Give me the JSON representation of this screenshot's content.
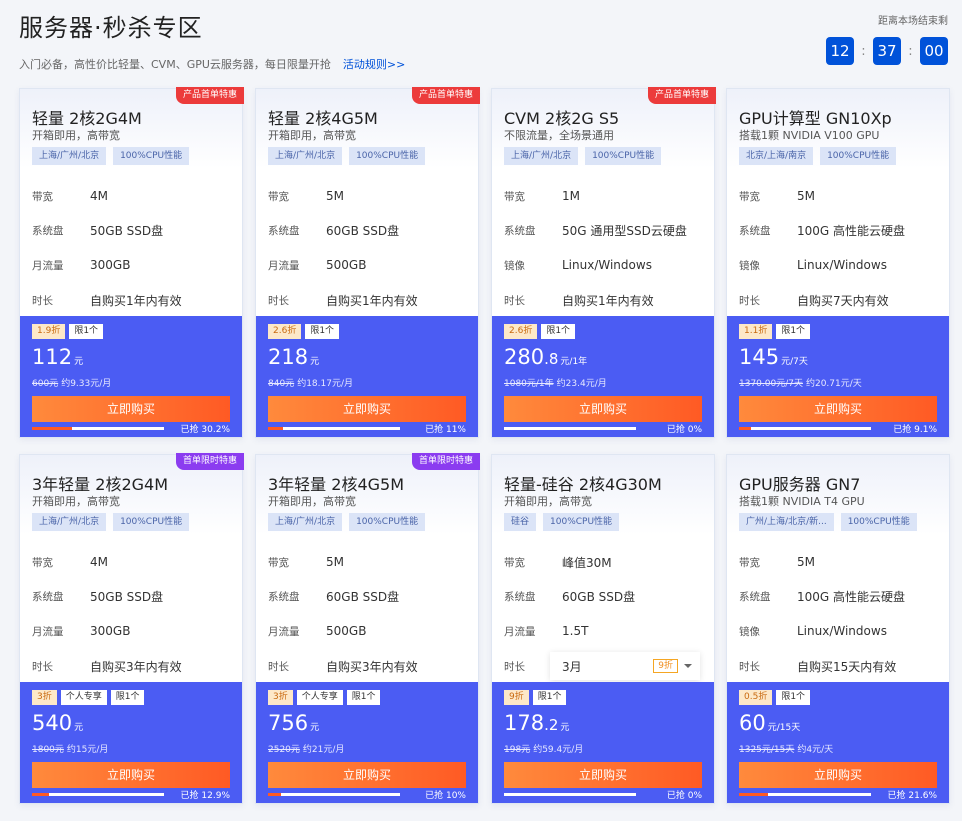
{
  "page": {
    "title": "服务器·秒杀专区",
    "subtitle": "入门必备，高性价比轻量、CVM、GPU云服务器，每日限量开抢",
    "rules_link": "活动规则>>"
  },
  "countdown": {
    "label": "距离本场结束剩",
    "hours": "12",
    "minutes": "37",
    "seconds": "00",
    "sep": ":"
  },
  "colors": {
    "accent": "#0052d9",
    "panel": "#4b5cf3",
    "buy": "#ff6a2a",
    "ribbon_red": "#ec3b3b",
    "ribbon_purple": "#8b3cf0"
  },
  "buy_label": "立即购买",
  "sold_prefix": "已抢",
  "cards": [
    {
      "ribbon": "产品首单特惠",
      "ribbon_color": "red",
      "name": "轻量 2核2G4M",
      "desc": "开箱即用，高带宽",
      "tags": [
        "上海/广州/北京",
        "100%CPU性能"
      ],
      "specs": [
        [
          "带宽",
          "4M"
        ],
        [
          "系统盘",
          "50GB SSD盘"
        ],
        [
          "月流量",
          "300GB"
        ],
        [
          "时长",
          "自购买1年内有效"
        ]
      ],
      "badges": [
        "1.9折",
        "限1个"
      ],
      "price_int": "112",
      "price_dec": "",
      "unit": "元",
      "orig": "600元",
      "monthly": "约9.33元/月",
      "sold_pct": "30.2%",
      "sold_frac": 0.302
    },
    {
      "ribbon": "产品首单特惠",
      "ribbon_color": "red",
      "name": "轻量 2核4G5M",
      "desc": "开箱即用，高带宽",
      "tags": [
        "上海/广州/北京",
        "100%CPU性能"
      ],
      "specs": [
        [
          "带宽",
          "5M"
        ],
        [
          "系统盘",
          "60GB SSD盘"
        ],
        [
          "月流量",
          "500GB"
        ],
        [
          "时长",
          "自购买1年内有效"
        ]
      ],
      "badges": [
        "2.6折",
        "限1个"
      ],
      "price_int": "218",
      "price_dec": "",
      "unit": "元",
      "orig": "840元",
      "monthly": "约18.17元/月",
      "sold_pct": "11%",
      "sold_frac": 0.11
    },
    {
      "ribbon": "产品首单特惠",
      "ribbon_color": "red",
      "name": "CVM 2核2G S5",
      "desc": "不限流量，全场景通用",
      "tags": [
        "上海/广州/北京",
        "100%CPU性能"
      ],
      "specs": [
        [
          "带宽",
          "1M"
        ],
        [
          "系统盘",
          "50G 通用型SSD云硬盘"
        ],
        [
          "镜像",
          "Linux/Windows"
        ],
        [
          "时长",
          "自购买1年内有效"
        ]
      ],
      "badges": [
        "2.6折",
        "限1个"
      ],
      "price_int": "280",
      "price_dec": ".8",
      "unit": "元/1年",
      "orig": "1080元/1年",
      "monthly": "约23.4元/月",
      "sold_pct": "0%",
      "sold_frac": 0
    },
    {
      "ribbon": "",
      "ribbon_color": "",
      "name": "GPU计算型 GN10Xp",
      "desc": "搭载1颗 NVIDIA V100 GPU",
      "tags": [
        "北京/上海/南京",
        "100%CPU性能"
      ],
      "specs": [
        [
          "带宽",
          "5M"
        ],
        [
          "系统盘",
          "100G 高性能云硬盘"
        ],
        [
          "镜像",
          "Linux/Windows"
        ],
        [
          "时长",
          "自购买7天内有效"
        ]
      ],
      "badges": [
        "1.1折",
        "限1个"
      ],
      "price_int": "145",
      "price_dec": "",
      "unit": "元/7天",
      "orig": "1370.00元/7天",
      "monthly": "约20.71元/天",
      "sold_pct": "9.1%",
      "sold_frac": 0.091
    },
    {
      "ribbon": "首单限时特惠",
      "ribbon_color": "purple",
      "name": "3年轻量 2核2G4M",
      "desc": "开箱即用，高带宽",
      "tags": [
        "上海/广州/北京",
        "100%CPU性能"
      ],
      "specs": [
        [
          "带宽",
          "4M"
        ],
        [
          "系统盘",
          "50GB SSD盘"
        ],
        [
          "月流量",
          "300GB"
        ],
        [
          "时长",
          "自购买3年内有效"
        ]
      ],
      "badges": [
        "3折",
        "个人专享",
        "限1个"
      ],
      "price_int": "540",
      "price_dec": "",
      "unit": "元",
      "orig": "1800元",
      "monthly": "约15元/月",
      "sold_pct": "12.9%",
      "sold_frac": 0.129
    },
    {
      "ribbon": "首单限时特惠",
      "ribbon_color": "purple",
      "name": "3年轻量 2核4G5M",
      "desc": "开箱即用，高带宽",
      "tags": [
        "上海/广州/北京",
        "100%CPU性能"
      ],
      "specs": [
        [
          "带宽",
          "5M"
        ],
        [
          "系统盘",
          "60GB SSD盘"
        ],
        [
          "月流量",
          "500GB"
        ],
        [
          "时长",
          "自购买3年内有效"
        ]
      ],
      "badges": [
        "3折",
        "个人专享",
        "限1个"
      ],
      "price_int": "756",
      "price_dec": "",
      "unit": "元",
      "orig": "2520元",
      "monthly": "约21元/月",
      "sold_pct": "10%",
      "sold_frac": 0.1
    },
    {
      "ribbon": "",
      "ribbon_color": "",
      "name": "轻量-硅谷 2核4G30M",
      "desc": "开箱即用，高带宽",
      "tags": [
        "硅谷",
        "100%CPU性能"
      ],
      "specs": [
        [
          "带宽",
          "峰值30M"
        ],
        [
          "系统盘",
          "60GB SSD盘"
        ],
        [
          "月流量",
          "1.5T"
        ]
      ],
      "duration_select": {
        "key": "时长",
        "value": "3月",
        "badge": "9折"
      },
      "badges": [
        "9折",
        "限1个"
      ],
      "price_int": "178",
      "price_dec": ".2",
      "unit": "元",
      "orig": "198元",
      "monthly": "约59.4元/月",
      "sold_pct": "0%",
      "sold_frac": 0
    },
    {
      "ribbon": "",
      "ribbon_color": "",
      "name": "GPU服务器 GN7",
      "desc": "搭载1颗 NVIDIA T4 GPU",
      "tags": [
        "广州/上海/北京/新...",
        "100%CPU性能"
      ],
      "specs": [
        [
          "带宽",
          "5M"
        ],
        [
          "系统盘",
          "100G 高性能云硬盘"
        ],
        [
          "镜像",
          "Linux/Windows"
        ],
        [
          "时长",
          "自购买15天内有效"
        ]
      ],
      "badges": [
        "0.5折",
        "限1个"
      ],
      "price_int": "60",
      "price_dec": "",
      "unit": "元/15天",
      "orig": "1325元/15天",
      "monthly": "约4元/天",
      "sold_pct": "21.6%",
      "sold_frac": 0.216
    }
  ]
}
